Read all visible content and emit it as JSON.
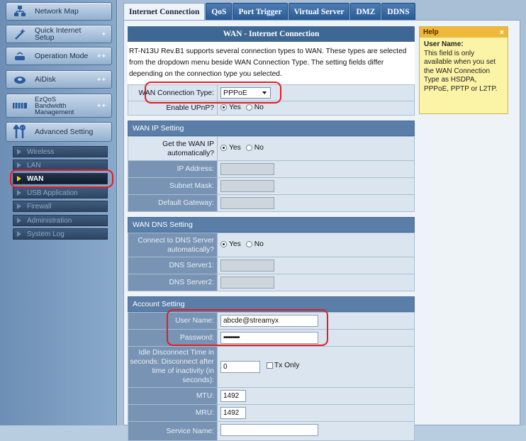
{
  "sidebar": {
    "main_items": [
      {
        "label": "Network Map"
      },
      {
        "label": "Quick Internet Setup"
      },
      {
        "label": "Operation Mode"
      },
      {
        "label": "AiDisk"
      },
      {
        "label": "EzQoS\nBandwidth\nManagement"
      },
      {
        "label": "Advanced Setting"
      }
    ],
    "sub_items": [
      {
        "label": "Wireless"
      },
      {
        "label": "LAN"
      },
      {
        "label": "WAN"
      },
      {
        "label": "USB Application"
      },
      {
        "label": "Firewall"
      },
      {
        "label": "Administration"
      },
      {
        "label": "System Log"
      }
    ]
  },
  "tabs": [
    "Internet Connection",
    "QoS",
    "Port Trigger",
    "Virtual Server",
    "DMZ",
    "DDNS"
  ],
  "form": {
    "title": "WAN - Internet Connection",
    "description": "RT-N13U Rev.B1 supports several connection types to WAN. These types are selected from the dropdown menu beside WAN Connection Type. The setting fields differ depending on the connection type you selected.",
    "wan_type_label": "WAN Connection Type:",
    "wan_type_value": "PPPoE",
    "upnp_label": "Enable UPnP?",
    "yes": "Yes",
    "no": "No",
    "ip_section": "WAN IP Setting",
    "ip_auto_label": "Get the WAN IP automatically?",
    "ip_address_label": "IP Address:",
    "subnet_label": "Subnet Mask:",
    "gateway_label": "Default Gateway:",
    "dns_section": "WAN DNS Setting",
    "dns_auto_label": "Connect to DNS Server automatically?",
    "dns1_label": "DNS Server1:",
    "dns2_label": "DNS Server2:",
    "account_section": "Account Setting",
    "username_label": "User Name:",
    "username_value": "abcde@streamyx",
    "password_label": "Password:",
    "password_value": "•••••••••",
    "idle_label": "Idle Disconnect Time in seconds: Disconnect after time of inactivity (in seconds):",
    "idle_value": "0",
    "tx_only": "Tx Only",
    "mtu_label": "MTU:",
    "mtu_value": "1492",
    "mru_label": "MRU:",
    "mru_value": "1492",
    "service_label": "Service Name:"
  },
  "help": {
    "title": "Help",
    "close": "×",
    "heading": "User Name:",
    "text": "This field is only available when you set the WAN Connection Type as HSDPA, PPPoE, PPTP or L2TP."
  }
}
